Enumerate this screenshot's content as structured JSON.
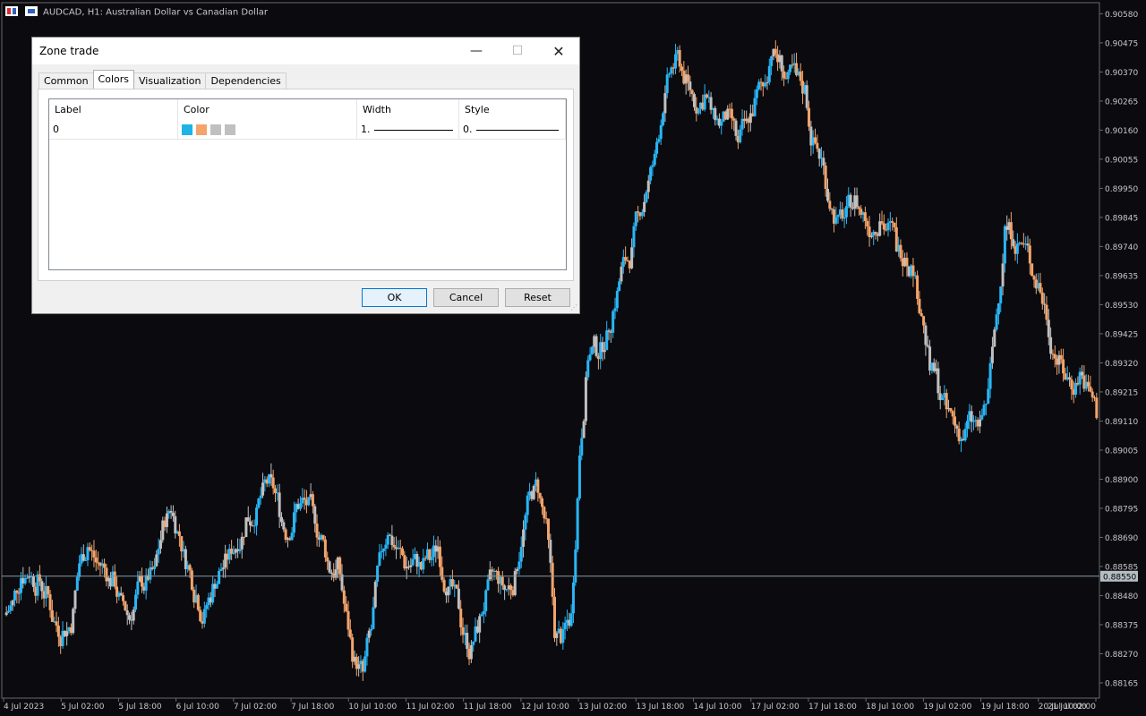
{
  "chart_header": {
    "symbol_text": "AUDCAD, H1:  Australian Dollar vs Canadian  Dollar"
  },
  "price_axis": {
    "labels": [
      "0.90580",
      "0.90475",
      "0.90370",
      "0.90265",
      "0.90160",
      "0.90055",
      "0.89950",
      "0.89845",
      "0.89740",
      "0.89635",
      "0.89530",
      "0.89425",
      "0.89320",
      "0.89215",
      "0.89110",
      "0.89005",
      "0.88900",
      "0.88795",
      "0.88690",
      "0.88585",
      "0.88480",
      "0.88375",
      "0.88270",
      "0.88165"
    ],
    "current_price": "0.88550"
  },
  "time_axis": {
    "labels": [
      "4 Jul 2023",
      "5 Jul 02:00",
      "5 Jul 18:00",
      "6 Jul 10:00",
      "7 Jul 02:00",
      "7 Jul 18:00",
      "10 Jul 10:00",
      "11 Jul 02:00",
      "11 Jul 18:00",
      "12 Jul 10:00",
      "13 Jul 02:00",
      "13 Jul 18:00",
      "14 Jul 10:00",
      "17 Jul 02:00",
      "17 Jul 18:00",
      "18 Jul 10:00",
      "19 Jul 02:00",
      "19 Jul 18:00",
      "20 Jul 10:00",
      "21 Jul 02:00"
    ]
  },
  "colors": {
    "background": "#0a0a0f",
    "bull": "#29b6f6",
    "bear": "#f4a46a",
    "neutral": "#c0c0c0",
    "axis_text": "#c8c8c8",
    "price_line": "#8a9aa0"
  },
  "chart_data": {
    "type": "candlestick",
    "ylim": [
      0.8811,
      0.9062
    ],
    "closes": [
      0.8845,
      0.8855,
      0.8857,
      0.8852,
      0.8848,
      0.8838,
      0.8834,
      0.8838,
      0.886,
      0.8866,
      0.886,
      0.8858,
      0.8853,
      0.8845,
      0.884,
      0.885,
      0.8852,
      0.8856,
      0.8872,
      0.888,
      0.887,
      0.8858,
      0.8848,
      0.884,
      0.885,
      0.8858,
      0.8862,
      0.8868,
      0.8875,
      0.8877,
      0.8885,
      0.8888,
      0.888,
      0.887,
      0.888,
      0.8882,
      0.8878,
      0.8868,
      0.8858,
      0.8858,
      0.884,
      0.8823,
      0.882,
      0.8836,
      0.886,
      0.8872,
      0.8865,
      0.886,
      0.886,
      0.8858,
      0.8862,
      0.8866,
      0.8852,
      0.8848,
      0.8835,
      0.8827,
      0.8838,
      0.885,
      0.8855,
      0.885,
      0.8852,
      0.8868,
      0.8884,
      0.8888,
      0.8872,
      0.8836,
      0.8832,
      0.884,
      0.89,
      0.8935,
      0.8938,
      0.894,
      0.895,
      0.8965,
      0.897,
      0.8985,
      0.8995,
      0.9005,
      0.9025,
      0.9038,
      0.9042,
      0.9032,
      0.9025,
      0.9028,
      0.902,
      0.9018,
      0.902,
      0.901,
      0.9018,
      0.9025,
      0.9032,
      0.9045,
      0.904,
      0.9033,
      0.9035,
      0.903,
      0.901,
      0.9005,
      0.899,
      0.8982,
      0.8985,
      0.899,
      0.8985,
      0.898,
      0.8985,
      0.898,
      0.8975,
      0.8972,
      0.8967,
      0.895,
      0.893,
      0.8925,
      0.8915,
      0.891,
      0.8905,
      0.8912,
      0.8908,
      0.892,
      0.895,
      0.898,
      0.8978,
      0.8975,
      0.897,
      0.896,
      0.895,
      0.8935,
      0.893,
      0.8925,
      0.8928,
      0.8922,
      0.8915
    ]
  },
  "dialog": {
    "title": "Zone trade",
    "minimize_glyph": "—",
    "maximize_glyph": "☐",
    "close_glyph": "✕",
    "tabs": [
      {
        "label": "Common"
      },
      {
        "label": "Colors"
      },
      {
        "label": "Visualization"
      },
      {
        "label": "Dependencies"
      }
    ],
    "grid": {
      "headers": {
        "label": "Label",
        "color": "Color",
        "width": "Width",
        "style": "Style"
      },
      "row": {
        "label": "0",
        "swatches": [
          "#1eb4e8",
          "#f4a46a",
          "#c0c0c0",
          "#c0c0c0"
        ],
        "width": "1.",
        "style": "0."
      }
    },
    "buttons": {
      "ok": "OK",
      "cancel": "Cancel",
      "reset": "Reset"
    }
  }
}
